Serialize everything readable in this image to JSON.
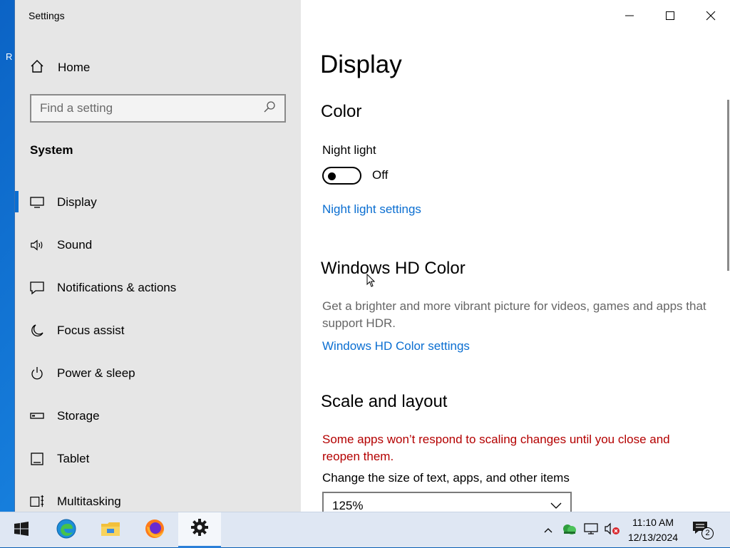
{
  "desktop": {
    "edge_text": "R"
  },
  "window": {
    "app_title": "Settings",
    "controls": {
      "minimize": "minimize",
      "maximize": "maximize",
      "close": "close"
    }
  },
  "sidebar": {
    "home_label": "Home",
    "search_placeholder": "Find a setting",
    "section_title": "System",
    "items": [
      {
        "label": "Display",
        "icon": "monitor-icon",
        "active": true
      },
      {
        "label": "Sound",
        "icon": "speaker-icon"
      },
      {
        "label": "Notifications & actions",
        "icon": "notification-icon"
      },
      {
        "label": "Focus assist",
        "icon": "moon-icon"
      },
      {
        "label": "Power & sleep",
        "icon": "power-icon"
      },
      {
        "label": "Storage",
        "icon": "storage-icon"
      },
      {
        "label": "Tablet",
        "icon": "tablet-icon"
      },
      {
        "label": "Multitasking",
        "icon": "multitasking-icon"
      }
    ]
  },
  "content": {
    "page_title": "Display",
    "color": {
      "heading": "Color",
      "night_light_label": "Night light",
      "night_light_state": "Off",
      "night_light_link": "Night light settings"
    },
    "hd_color": {
      "heading": "Windows HD Color",
      "description": "Get a brighter and more vibrant picture for videos, games and apps that support HDR.",
      "link": "Windows HD Color settings"
    },
    "scale": {
      "heading": "Scale and layout",
      "warning": "Some apps won’t respond to scaling changes until you close and reopen them.",
      "size_label": "Change the size of text, apps, and other items",
      "size_value": "125%"
    }
  },
  "taskbar": {
    "apps": [
      "start-icon",
      "edge-icon",
      "file-explorer-icon",
      "firefox-icon",
      "settings-gear-icon"
    ],
    "clock_time": "11:10 AM",
    "clock_date": "12/13/2024",
    "notification_count": "2"
  },
  "colors": {
    "accent": "#0a6ed1",
    "warning": "#b40000",
    "sidebar_bg": "#e6e6e6"
  }
}
